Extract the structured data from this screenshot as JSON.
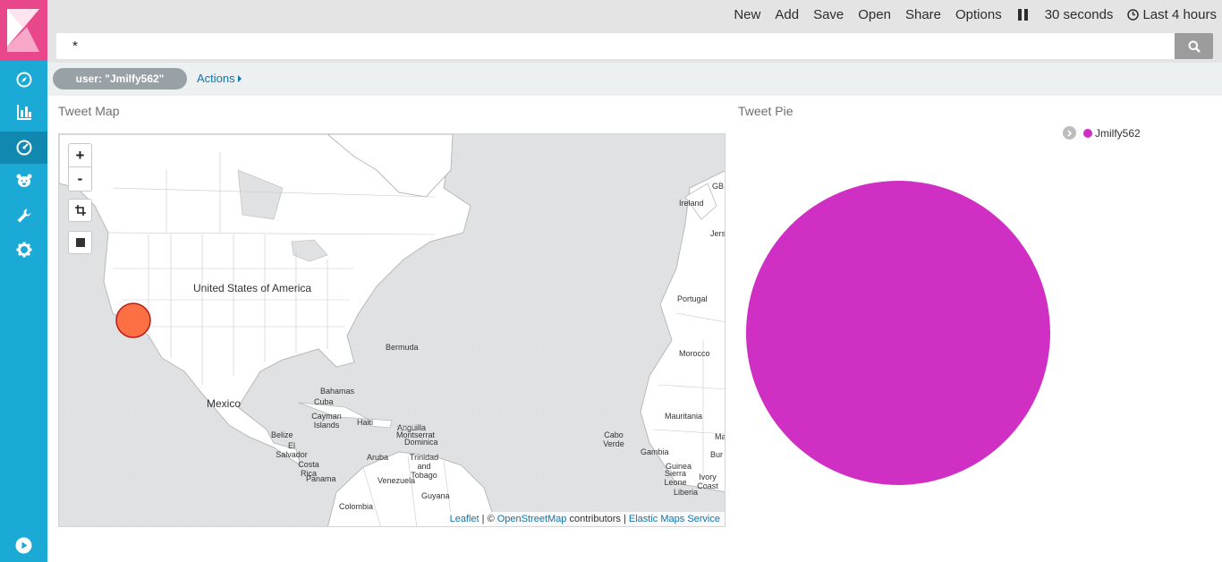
{
  "menu": {
    "items": [
      "New",
      "Add",
      "Save",
      "Open",
      "Share",
      "Options"
    ],
    "refresh_interval": "30 seconds",
    "time_range": "Last 4 hours"
  },
  "search": {
    "query": "*"
  },
  "filters": {
    "pill": "user: \"Jmilfy562\"",
    "actions_label": "Actions"
  },
  "sidebar": {
    "icons": [
      "compass-icon",
      "bar-chart-icon",
      "dashboard-gauge-icon",
      "bear-icon",
      "wrench-icon",
      "gear-icon",
      "play-icon"
    ]
  },
  "panels": {
    "map": {
      "title": "Tweet Map",
      "zoom_in": "+",
      "zoom_out": "-",
      "labels": {
        "usa": "United States of America",
        "mexico": "Mexico",
        "bermuda": "Bermuda",
        "bahamas": "Bahamas",
        "cuba": "Cuba",
        "cayman": "Cayman Islands",
        "haiti": "Haiti",
        "anguilla": "Anguilla",
        "montserrat": "Montserrat",
        "dominica": "Dominica",
        "belize": "Belize",
        "elsalvador": "El Salvador",
        "costarica": "Costa Rica",
        "panama": "Panama",
        "aruba": "Aruba",
        "venezuela": "Venezuela",
        "trinidad": "Trinidad and Tobago",
        "guyana": "Guyana",
        "colombia": "Colombia",
        "caboverde": "Cabo Verde",
        "ireland": "Ireland",
        "gb": "GB",
        "jersey": "Jers",
        "portugal": "Portugal",
        "morocco": "Morocco",
        "mauritania": "Mauritania",
        "gambia": "Gambia",
        "guinea": "Guinea",
        "sierraleone": "Sierra Leone",
        "liberia": "Liberia",
        "ivorycoast": "Ivory Coast",
        "mali_partial": "Ma",
        "burkina_partial": "Bur"
      },
      "attribution": {
        "leaflet": "Leaflet",
        "sep1": " | © ",
        "osm": "OpenStreetMap",
        "contributors": " contributors | ",
        "ems": "Elastic Maps Service"
      },
      "marker_color": "#fd7043"
    },
    "pie": {
      "title": "Tweet Pie"
    }
  },
  "chart_data": {
    "type": "pie",
    "categories": [
      "Jmilfy562"
    ],
    "values": [
      1
    ],
    "colors": [
      "#d02fc4"
    ],
    "legend": "top-right"
  },
  "colors": {
    "sidebar": "#1ba9d5",
    "logo": "#e8488b",
    "link": "#1275a8"
  }
}
